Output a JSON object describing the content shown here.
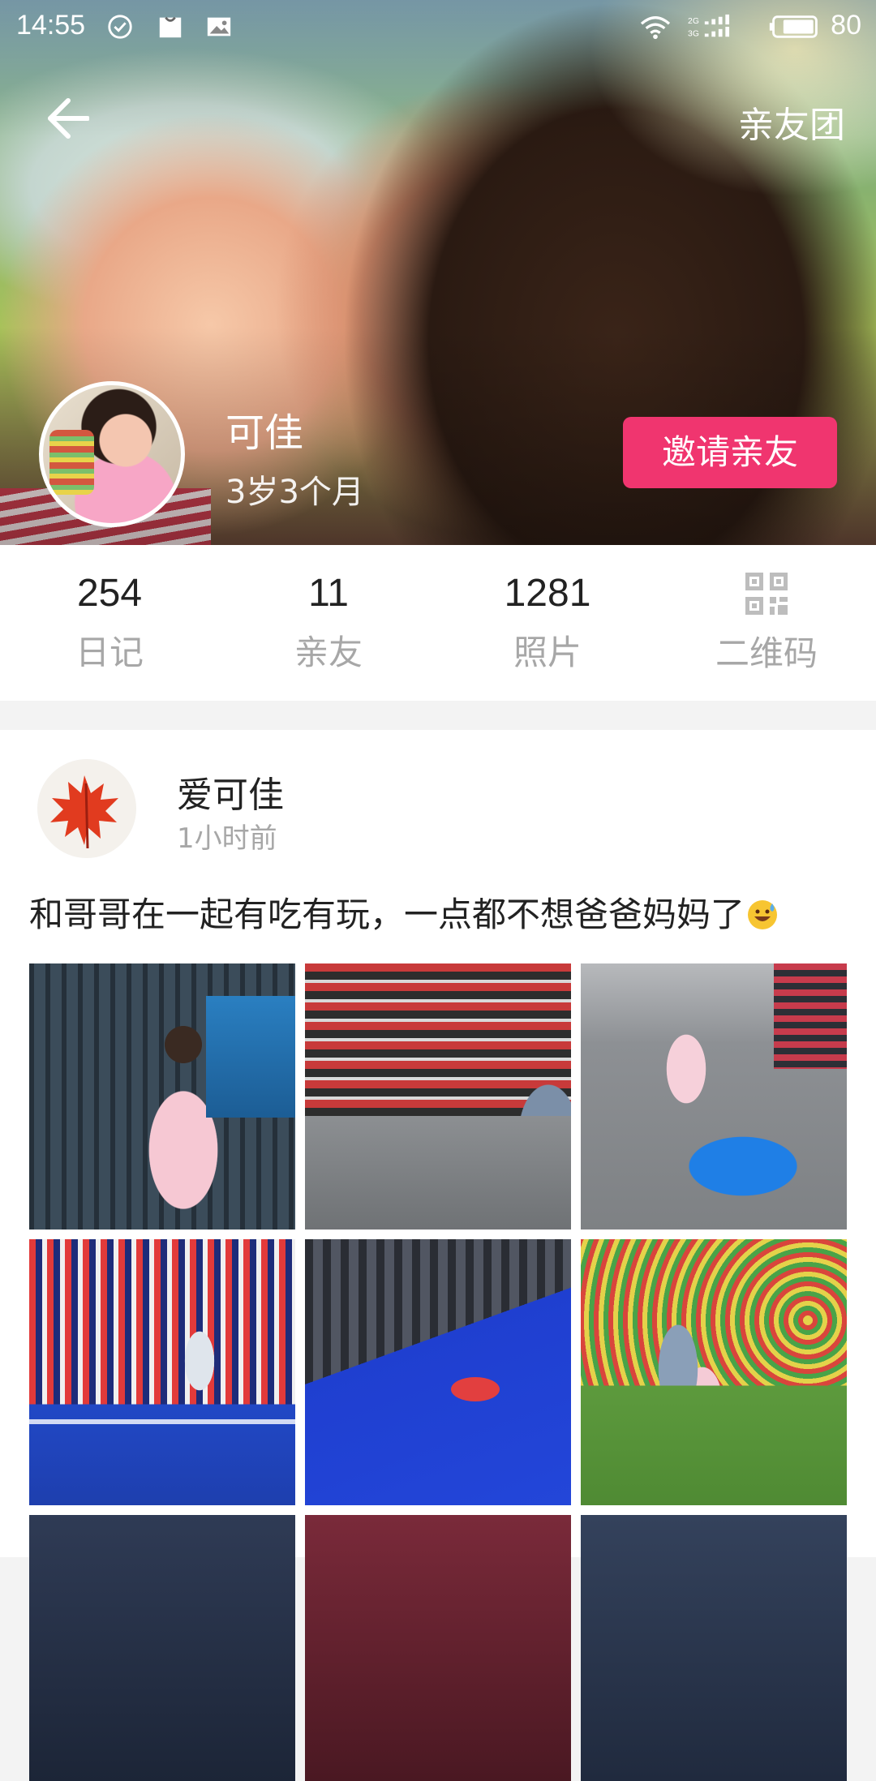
{
  "status_bar": {
    "time": "14:55",
    "battery_percent": "80",
    "network": "2G 3G"
  },
  "header": {
    "back_icon": "arrow-left-icon",
    "friends_group_label": "亲友团"
  },
  "profile": {
    "name": "可佳",
    "age": "3岁3个月",
    "invite_button_label": "邀请亲友"
  },
  "stats": [
    {
      "value": "254",
      "label": "日记"
    },
    {
      "value": "11",
      "label": "亲友"
    },
    {
      "value": "1281",
      "label": "照片"
    },
    {
      "icon": "qrcode-icon",
      "label": "二维码"
    }
  ],
  "post": {
    "author": "爱可佳",
    "time": "1小时前",
    "text": "和哥哥在一起有吃有玩，一点都不想爸爸妈妈了",
    "emoji": "sweat-smile-emoji",
    "photo_count_visible": 9
  },
  "colors": {
    "accent": "#f0356f",
    "muted_text": "#a7a7a7",
    "primary_text": "#222222",
    "background": "#f3f3f3"
  }
}
